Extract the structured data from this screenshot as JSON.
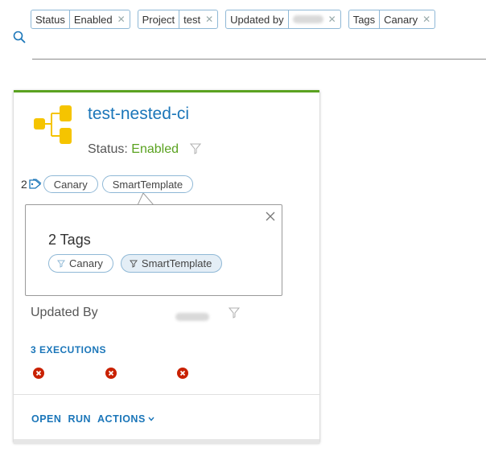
{
  "filters": [
    {
      "key": "Status",
      "value": "Enabled"
    },
    {
      "key": "Project",
      "value": "test"
    },
    {
      "key": "Updated by",
      "value": ""
    },
    {
      "key": "Tags",
      "value": "Canary"
    }
  ],
  "card": {
    "title": "test-nested-ci",
    "status_label": "Status:",
    "status_value": "Enabled",
    "tag_count": "2",
    "tags": [
      "Canary",
      "SmartTemplate"
    ],
    "updated_by_label": "Updated By",
    "executions_link": "3 EXECUTIONS",
    "execution_statuses": [
      "failed",
      "failed",
      "failed"
    ],
    "actions": {
      "open": "OPEN",
      "run": "RUN",
      "actions": "ACTIONS"
    }
  },
  "popover": {
    "title": "2 Tags",
    "tags": [
      "Canary",
      "SmartTemplate"
    ]
  },
  "colors": {
    "accent": "#1b76b9",
    "enabled_green": "#5aa220",
    "error_red": "#c92100",
    "icon_yellow": "#f5c400",
    "chip_border": "#8fb8d6"
  }
}
